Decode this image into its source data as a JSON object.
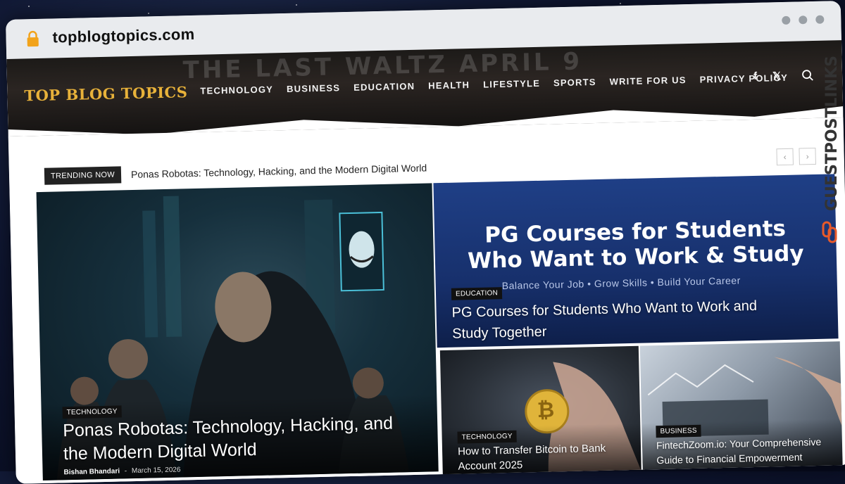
{
  "browser": {
    "url": "topblogtopics.com"
  },
  "site": {
    "logo": "TOP BLOG TOPICS",
    "header_sign": "THE LAST WALTZ APRIL 9",
    "nav": [
      "TECHNOLOGY",
      "BUSINESS",
      "EDUCATION",
      "HEALTH",
      "LIFESTYLE",
      "SPORTS",
      "WRITE FOR US",
      "PRIVACY POLICY"
    ],
    "social": {
      "facebook": "f",
      "x": "𝕏"
    }
  },
  "trending": {
    "label": "TRENDING NOW",
    "headline": "Ponas Robotas: Technology, Hacking, and the Modern Digital World",
    "prev": "‹",
    "next": "›"
  },
  "featured": {
    "category": "TECHNOLOGY",
    "title": "Ponas Robotas: Technology, Hacking, and the Modern Digital World",
    "author": "Bishan Bhandari",
    "separator": "-",
    "date": "March 15, 2026"
  },
  "pg_card": {
    "banner_line1": "PG Courses for Students",
    "banner_line2": "Who Want to Work & Study",
    "banner_sub": "Balance Your Job • Grow Skills • Build Your Career",
    "category": "EDUCATION",
    "title": "PG Courses for Students Who Want to Work and Study Together"
  },
  "btc_card": {
    "category": "TECHNOLOGY",
    "title": "How to Transfer Bitcoin to Bank Account 2025",
    "coin_symbol": "₿"
  },
  "fin_card": {
    "category": "BUSINESS",
    "title": "FintechZoom.io: Your Comprehensive Guide to Financial Empowerment"
  },
  "watermark": {
    "text": "GUESTPOSTLINKS"
  },
  "colors": {
    "logo": "#e8b23a",
    "pg_blue": "#1f3f86",
    "brand_orange": "#e85a2a"
  }
}
